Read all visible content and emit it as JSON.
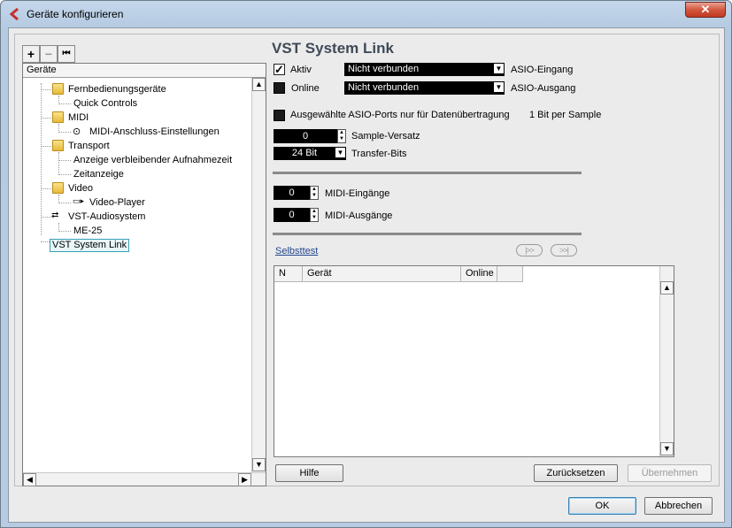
{
  "window": {
    "title": "Geräte konfigurieren",
    "close_label": "✕"
  },
  "toolbar": {
    "add": "+",
    "remove": "−",
    "reset": "⏮"
  },
  "tree": {
    "header": "Geräte",
    "nodes": [
      "Fernbedienungsgeräte",
      "Quick Controls",
      "MIDI",
      "MIDI-Anschluss-Einstellungen",
      "Transport",
      "Anzeige verbleibender Aufnahmezeit",
      "Zeitanzeige",
      "Video",
      "Video-Player",
      "VST-Audiosystem",
      "ME-25",
      "VST System Link"
    ]
  },
  "panel": {
    "title": "VST System Link",
    "aktiv_label": "Aktiv",
    "online_label": "Online",
    "input_combo": "Nicht verbunden",
    "output_combo": "Nicht verbunden",
    "asio_in": "ASIO-Eingang",
    "asio_out": "ASIO-Ausgang",
    "data_ports_label": "Ausgewählte ASIO-Ports nur für Datenübertragung",
    "bit_per_sample": "1 Bit per Sample",
    "sample_offset_value": "0",
    "sample_offset_label": "Sample-Versatz",
    "transfer_bits_value": "24 Bit",
    "transfer_bits_label": "Transfer-Bits",
    "midi_in_value": "0",
    "midi_in_label": "MIDI-Eingänge",
    "midi_out_value": "0",
    "midi_out_label": "MIDI-Ausgänge",
    "selftest": "Selbsttest",
    "nav_prev": "|>>",
    "nav_next": ">>|",
    "columns": [
      "N",
      "Gerät",
      "Online",
      ""
    ]
  },
  "buttons": {
    "help": "Hilfe",
    "reset": "Zurücksetzen",
    "apply": "Übernehmen",
    "ok": "OK",
    "cancel": "Abbrechen"
  }
}
